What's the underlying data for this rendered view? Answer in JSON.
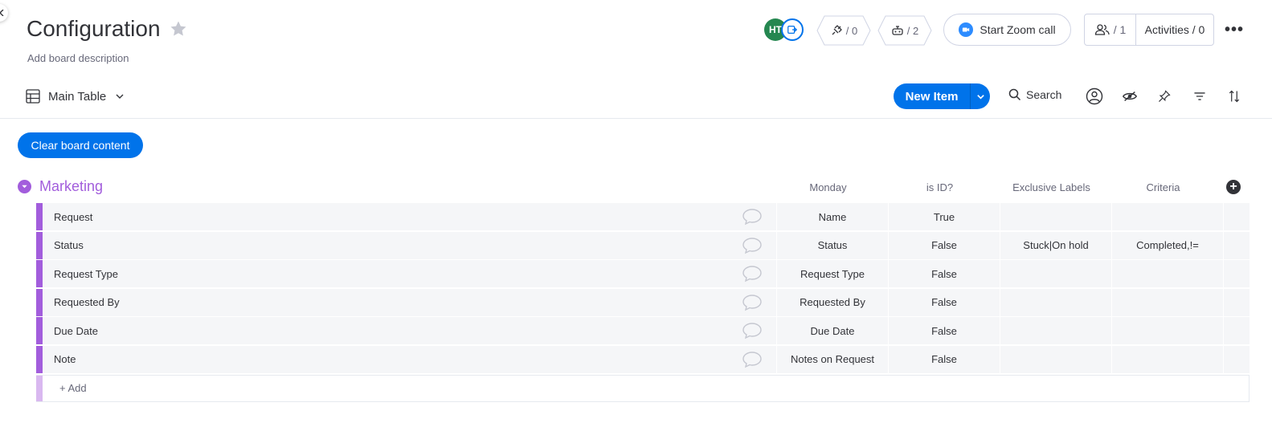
{
  "board": {
    "title": "Configuration",
    "description": "Add board description"
  },
  "header": {
    "avatar_initials": "HT",
    "integrations_count": "/ 0",
    "automations_count": "/ 2",
    "zoom_label": "Start Zoom call",
    "people_count": "/ 1",
    "activities_label": "Activities / 0"
  },
  "toolbar": {
    "view_name": "Main Table",
    "new_item_label": "New Item",
    "search_label": "Search"
  },
  "actions": {
    "clear_label": "Clear board content"
  },
  "group": {
    "title": "Marketing",
    "color": "#a25ddc",
    "columns": [
      "Monday",
      "is ID?",
      "Exclusive Labels",
      "Criteria"
    ],
    "rows": [
      {
        "name": "Request",
        "monday": "Name",
        "is_id": "True",
        "exclusive": "",
        "criteria": ""
      },
      {
        "name": "Status",
        "monday": "Status",
        "is_id": "False",
        "exclusive": "Stuck|On hold",
        "criteria": "Completed,!="
      },
      {
        "name": "Request Type",
        "monday": "Request Type",
        "is_id": "False",
        "exclusive": "",
        "criteria": ""
      },
      {
        "name": "Requested By",
        "monday": "Requested By",
        "is_id": "False",
        "exclusive": "",
        "criteria": ""
      },
      {
        "name": "Due Date",
        "monday": "Due Date",
        "is_id": "False",
        "exclusive": "",
        "criteria": ""
      },
      {
        "name": "Note",
        "monday": "Notes on Request",
        "is_id": "False",
        "exclusive": "",
        "criteria": ""
      }
    ],
    "add_label": "+ Add"
  },
  "colors": {
    "primary": "#0073ea",
    "group": "#a25ddc",
    "avatar": "#258750",
    "zoom": "#2d8cff"
  }
}
